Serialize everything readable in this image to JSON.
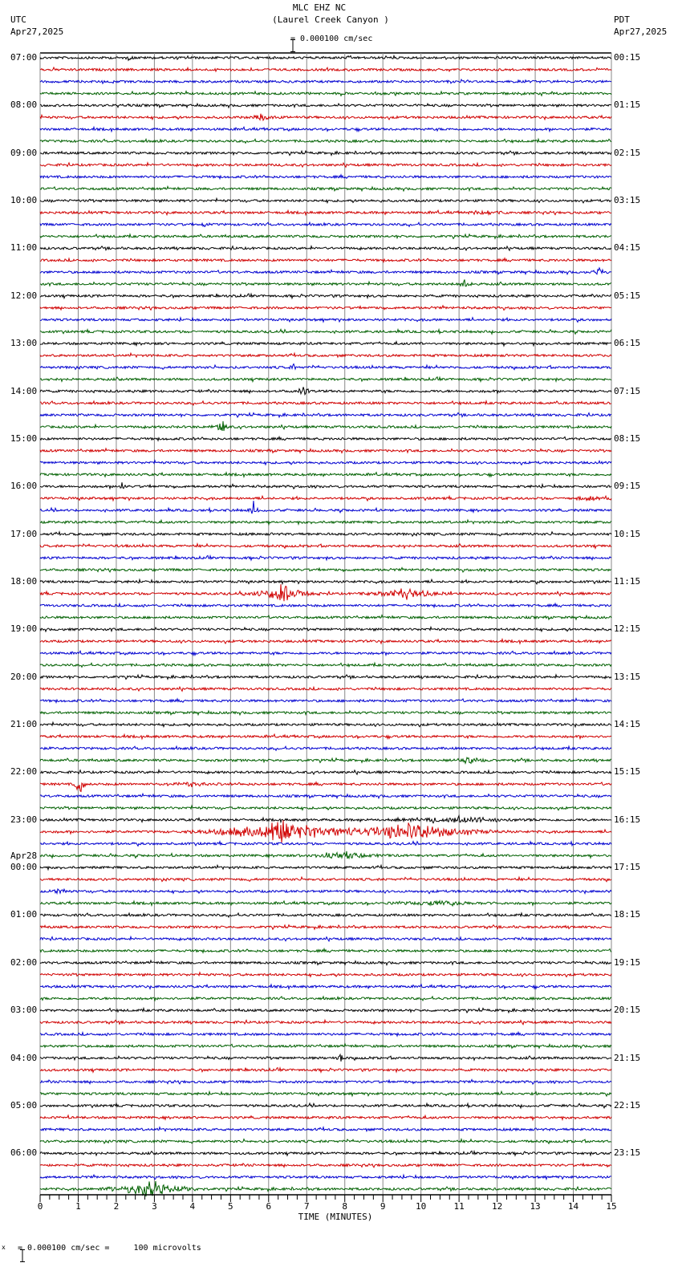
{
  "header": {
    "station": "MLC EHZ NC",
    "location": "(Laurel Creek Canyon )",
    "left_tz": "UTC",
    "left_date": "Apr27,2025",
    "right_tz": "PDT",
    "right_date": "Apr27,2025",
    "scale": "= 0.000100 cm/sec"
  },
  "footer": {
    "scale": "= 0.000100 cm/sec =     100 microvolts",
    "prefix": "x"
  },
  "chart_data": {
    "type": "line",
    "title": "MLC EHZ NC (Laurel Creek Canyon )",
    "xlabel": "TIME (MINUTES)",
    "xlim": [
      0,
      15
    ],
    "x_ticks": [
      "0",
      "1",
      "2",
      "3",
      "4",
      "5",
      "6",
      "7",
      "8",
      "9",
      "10",
      "11",
      "12",
      "13",
      "14",
      "15"
    ],
    "rows_per_hour": 4,
    "minutes_per_row": 15,
    "trace_colors": [
      "#000000",
      "#d00000",
      "#0000d0",
      "#006000"
    ],
    "left_labels": [
      "07:00",
      "08:00",
      "09:00",
      "10:00",
      "11:00",
      "12:00",
      "13:00",
      "14:00",
      "15:00",
      "16:00",
      "17:00",
      "18:00",
      "19:00",
      "20:00",
      "21:00",
      "22:00",
      "23:00",
      "00:00",
      "01:00",
      "02:00",
      "03:00",
      "04:00",
      "05:00",
      "06:00"
    ],
    "date_change_label": "Apr28",
    "right_labels": [
      "00:15",
      "01:15",
      "02:15",
      "03:15",
      "04:15",
      "05:15",
      "06:15",
      "07:15",
      "08:15",
      "09:15",
      "10:15",
      "11:15",
      "12:15",
      "13:15",
      "14:15",
      "15:15",
      "16:15",
      "17:15",
      "18:15",
      "19:15",
      "20:15",
      "21:15",
      "22:15",
      "23:15"
    ],
    "events": [
      {
        "row": 0,
        "minute": 2.35,
        "amp": 6,
        "dur": 0.1
      },
      {
        "row": 5,
        "minute": 5.8,
        "amp": 4,
        "dur": 0.5
      },
      {
        "row": 13,
        "minute": 11.7,
        "amp": 4,
        "dur": 0.6
      },
      {
        "row": 14,
        "minute": 4.3,
        "amp": 4,
        "dur": 0.2
      },
      {
        "row": 18,
        "minute": 14.7,
        "amp": 6,
        "dur": 0.3
      },
      {
        "row": 19,
        "minute": 11.15,
        "amp": 10,
        "dur": 0.2
      },
      {
        "row": 26,
        "minute": 6.65,
        "amp": 5,
        "dur": 0.15
      },
      {
        "row": 28,
        "minute": 6.9,
        "amp": 10,
        "dur": 0.2
      },
      {
        "row": 31,
        "minute": 4.75,
        "amp": 12,
        "dur": 0.25
      },
      {
        "row": 36,
        "minute": 2.15,
        "amp": 7,
        "dur": 0.1
      },
      {
        "row": 37,
        "minute": 14.4,
        "amp": 4,
        "dur": 0.5
      },
      {
        "row": 38,
        "minute": 5.6,
        "amp": 12,
        "dur": 0.15
      },
      {
        "row": 45,
        "minute": 6.35,
        "amp": 14,
        "dur": 1.0
      },
      {
        "row": 45,
        "minute": 9.6,
        "amp": 8,
        "dur": 1.2
      },
      {
        "row": 59,
        "minute": 11.2,
        "amp": 6,
        "dur": 0.5
      },
      {
        "row": 61,
        "minute": 1.05,
        "amp": 40,
        "dur": 0.15
      },
      {
        "row": 61,
        "minute": 4.0,
        "amp": 3,
        "dur": 0.8
      },
      {
        "row": 64,
        "minute": 11.0,
        "amp": 4,
        "dur": 2.0
      },
      {
        "row": 65,
        "minute": 6.3,
        "amp": 18,
        "dur": 2.5
      },
      {
        "row": 65,
        "minute": 9.7,
        "amp": 14,
        "dur": 2.6
      },
      {
        "row": 67,
        "minute": 8.0,
        "amp": 5,
        "dur": 1.2
      },
      {
        "row": 70,
        "minute": 0.5,
        "amp": 6,
        "dur": 0.2
      },
      {
        "row": 71,
        "minute": 10.5,
        "amp": 3,
        "dur": 1.5
      },
      {
        "row": 84,
        "minute": 7.9,
        "amp": 6,
        "dur": 0.1
      },
      {
        "row": 95,
        "minute": 2.9,
        "amp": 14,
        "dur": 1.4
      }
    ]
  }
}
